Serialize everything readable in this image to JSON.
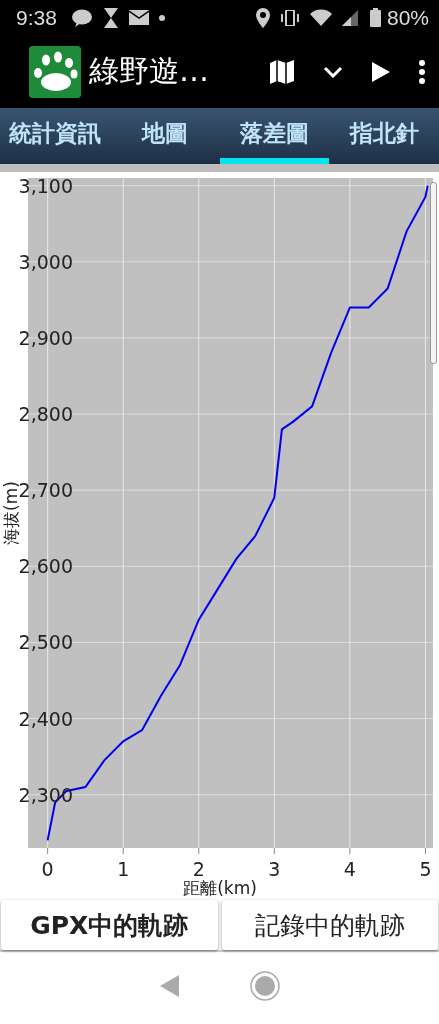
{
  "status_bar": {
    "time": "9:38",
    "battery": "80%"
  },
  "app_bar": {
    "title": "綠野遊…"
  },
  "tabs": [
    {
      "label": "統計資訊",
      "selected": false
    },
    {
      "label": "地圖",
      "selected": false
    },
    {
      "label": "落差圖",
      "selected": true
    },
    {
      "label": "指北針",
      "selected": false
    }
  ],
  "chart": {
    "chart_data": {
      "type": "line",
      "xlabel": "距離(km)",
      "ylabel": "海拔(m)",
      "x": [
        0,
        0.1,
        0.25,
        0.5,
        0.75,
        1,
        1.25,
        1.5,
        1.75,
        2,
        2.25,
        2.5,
        2.75,
        3,
        3.1,
        3.25,
        3.5,
        3.75,
        4,
        4.25,
        4.5,
        4.75,
        5,
        5.03
      ],
      "series": [
        {
          "color": "#0000ee",
          "values": [
            2240,
            2290,
            2305,
            2310,
            2345,
            2370,
            2385,
            2430,
            2470,
            2530,
            2570,
            2610,
            2640,
            2690,
            2780,
            2790,
            2810,
            2880,
            2940,
            2940,
            2965,
            3040,
            3085,
            3100
          ]
        }
      ],
      "xlim": [
        -0.26,
        5.1
      ],
      "ylim": [
        2230,
        3110
      ],
      "xticks": [
        0,
        1,
        2,
        3,
        4,
        5
      ],
      "grid": true,
      "yticks": [
        {
          "value": 2300,
          "label": "2,300"
        },
        {
          "value": 2400,
          "label": "2,400"
        },
        {
          "value": 2500,
          "label": "2,500"
        },
        {
          "value": 2600,
          "label": "2,600"
        },
        {
          "value": 2700,
          "label": "2,700"
        },
        {
          "value": 2800,
          "label": "2,800"
        },
        {
          "value": 2900,
          "label": "2,900"
        },
        {
          "value": 3000,
          "label": "3,000"
        },
        {
          "value": 3100,
          "label": "3,100"
        }
      ]
    }
  },
  "buttons": [
    "GPX中的軌跡",
    "記錄中的軌跡"
  ]
}
